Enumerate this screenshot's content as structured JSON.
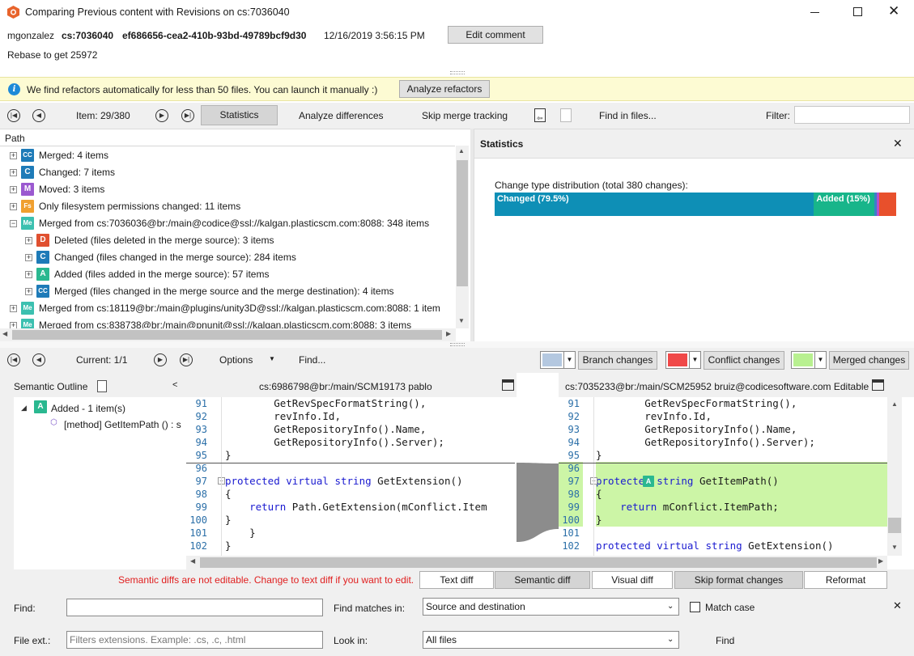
{
  "window": {
    "title": "Comparing Previous content with Revisions on cs:7036040"
  },
  "header": {
    "user": "mgonzalez",
    "changeset": "cs:7036040",
    "guid": "ef686656-cea2-410b-93bd-49789bcf9d30",
    "date": "12/16/2019 3:56:15 PM",
    "edit_comment": "Edit comment",
    "comment": "Rebase to get 25972"
  },
  "infobar": {
    "message": "We find refactors automatically for less than 50 files. You can launch it manually :)",
    "button": "Analyze refactors"
  },
  "toolbar": {
    "item_label": "Item: 29/380",
    "statistics": "Statistics",
    "analyze_differences": "Analyze differences",
    "skip_merge_tracking": "Skip merge tracking",
    "find_in_files": "Find in files...",
    "filter_label": "Filter:"
  },
  "tree": {
    "header": "Path",
    "rows": [
      {
        "badge": "CC",
        "color": "#1e7bb8",
        "label": "Merged: 4 items"
      },
      {
        "badge": "C",
        "color": "#1e7bb8",
        "label": "Changed: 7 items"
      },
      {
        "badge": "M",
        "color": "#9b59d0",
        "label": "Moved: 3 items"
      },
      {
        "badge": "Fs",
        "color": "#f0a030",
        "label": "Only filesystem permissions changed: 11 items"
      },
      {
        "badge": "Me",
        "color": "#3cc0b0",
        "label": "Merged from cs:7036036@br:/main@codice@ssl://kalgan.plasticscm.com:8088: 348 items"
      },
      {
        "badge": "D",
        "color": "#e05030",
        "label": "Deleted (files deleted in the merge source): 3 items"
      },
      {
        "badge": "C",
        "color": "#1e7bb8",
        "label": "Changed (files changed in the merge source): 284 items"
      },
      {
        "badge": "A",
        "color": "#2ab890",
        "label": "Added (files added in the merge source): 57 items"
      },
      {
        "badge": "CC",
        "color": "#1e7bb8",
        "label": "Merged (files changed in the merge source and the merge destination): 4 items"
      },
      {
        "badge": "Me",
        "color": "#3cc0b0",
        "label": "Merged from cs:18119@br:/main@plugins/unity3D@ssl://kalgan.plasticscm.com:8088: 1 item"
      },
      {
        "badge": "Me",
        "color": "#3cc0b0",
        "label": "Merged from cs:838738@br:/main@pnunit@ssl://kalgan.plasticscm.com:8088: 3 items"
      }
    ]
  },
  "statistics": {
    "title": "Statistics",
    "distribution_label": "Change type distribution (total 380 changes):",
    "changed_label": "Changed (79.5%)",
    "added_label": "Added (15%)",
    "changed_pct": 79.5,
    "added_pct": 15,
    "changed_color": "#0e8fb6",
    "added_color": "#18b58a"
  },
  "diffbar": {
    "current": "Current: 1/1",
    "options": "Options",
    "find": "Find...",
    "branch_changes": "Branch changes",
    "conflict_changes": "Conflict changes",
    "merged_changes": "Merged changes"
  },
  "outline": {
    "title": "Semantic Outline",
    "added": "Added - 1 item(s)",
    "method": "[method] GetItemPath () : s"
  },
  "left_pane": {
    "header": "cs:6986798@br:/main/SCM19173 pablo",
    "lines": [
      {
        "n": "91",
        "t": "                GetRevSpecFormatString(),"
      },
      {
        "n": "92",
        "t": "                revInfo.Id,"
      },
      {
        "n": "93",
        "t": "                GetRepositoryInfo().Name,"
      },
      {
        "n": "94",
        "t": "                GetRepositoryInfo().Server);"
      },
      {
        "n": "95",
        "t": "        }"
      },
      {
        "n": "96",
        "t": ""
      },
      {
        "n": "97",
        "t": "        protected virtual string GetExtension()"
      },
      {
        "n": "98",
        "t": "        {"
      },
      {
        "n": "99",
        "t": "            return Path.GetExtension(mConflict.Item"
      },
      {
        "n": "100",
        "t": "        }"
      },
      {
        "n": "101",
        "t": "    }"
      },
      {
        "n": "102",
        "t": "}"
      }
    ]
  },
  "right_pane": {
    "header": "cs:7035233@br:/main/SCM25952 bruiz@codicesoftware.com Editable",
    "lines": [
      {
        "n": "91",
        "t": "                GetRevSpecFormatString(),"
      },
      {
        "n": "92",
        "t": "                revInfo.Id,"
      },
      {
        "n": "93",
        "t": "                GetRepositoryInfo().Name,"
      },
      {
        "n": "94",
        "t": "                GetRepositoryInfo().Server);"
      },
      {
        "n": "95",
        "t": "        }"
      },
      {
        "n": "96",
        "t": ""
      },
      {
        "n": "97",
        "t": "        protected string GetItemPath()"
      },
      {
        "n": "98",
        "t": "        {"
      },
      {
        "n": "99",
        "t": "            return mConflict.ItemPath;"
      },
      {
        "n": "100",
        "t": "        }"
      },
      {
        "n": "101",
        "t": ""
      },
      {
        "n": "102",
        "t": "        protected virtual string GetExtension()"
      }
    ]
  },
  "bottom_bar": {
    "warning": "Semantic diffs are not editable. Change to text diff if you want to edit.",
    "text_diff": "Text diff",
    "semantic_diff": "Semantic diff",
    "visual_diff": "Visual diff",
    "skip_format": "Skip format changes",
    "reformat": "Reformat"
  },
  "find_panel": {
    "find_label": "Find:",
    "find_matches_label": "Find matches in:",
    "find_matches_value": "Source and destination",
    "match_case": "Match case",
    "file_ext_label": "File ext.:",
    "file_ext_placeholder": "Filters extensions. Example: .cs, .c, .html",
    "look_in_label": "Look in:",
    "look_in_value": "All files",
    "find_button": "Find"
  }
}
